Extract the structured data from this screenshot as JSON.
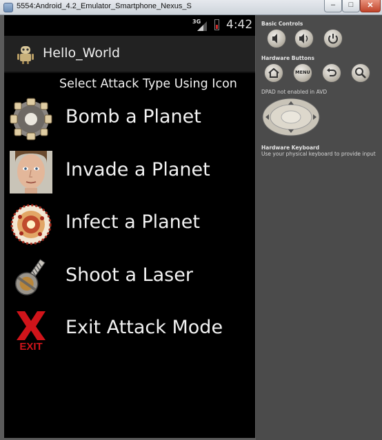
{
  "window": {
    "title": "5554:Android_4.2_Emulator_Smartphone_Nexus_S",
    "minimize_label": "–",
    "maximize_label": "□",
    "close_label": "✕"
  },
  "status_bar": {
    "network": "3G",
    "time": "4:42",
    "battery_color": "#d12b2b"
  },
  "action_bar": {
    "app_title": "Hello_World",
    "icon": "android-robot-icon"
  },
  "content": {
    "prompt": "Select Attack Type Using Icon",
    "items": [
      {
        "label": "Bomb a Planet",
        "icon": "bomb-icon"
      },
      {
        "label": "Invade a Planet",
        "icon": "invader-face-icon"
      },
      {
        "label": "Infect a Planet",
        "icon": "virus-icon"
      },
      {
        "label": "Shoot a Laser",
        "icon": "laser-drill-icon"
      },
      {
        "label": "Exit Attack Mode",
        "icon": "exit-icon",
        "icon_text": "EXIT"
      }
    ]
  },
  "controls_panel": {
    "basic_controls_title": "Basic Controls",
    "basic_controls": [
      "volume-down-icon",
      "volume-up-icon",
      "power-icon"
    ],
    "hardware_buttons_title": "Hardware Buttons",
    "hardware_buttons": [
      "home-icon",
      "menu-button",
      "back-icon",
      "search-icon"
    ],
    "menu_label": "MENU",
    "dpad_title": "DPAD not enabled in AVD",
    "hardware_keyboard_title": "Hardware Keyboard",
    "hardware_keyboard_hint": "Use your physical keyboard to provide input"
  },
  "colors": {
    "phone_background": "#000000",
    "action_bar": "#222222",
    "panel_background": "#4b4b4b",
    "exit_red": "#d0141a"
  }
}
